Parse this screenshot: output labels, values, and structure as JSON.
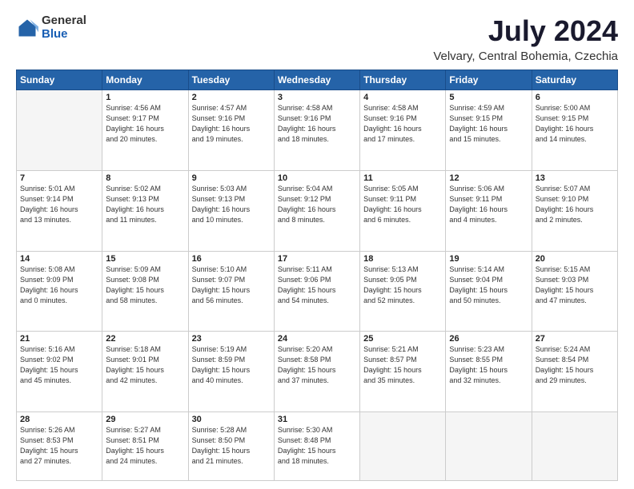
{
  "header": {
    "logo_general": "General",
    "logo_blue": "Blue",
    "title": "July 2024",
    "subtitle": "Velvary, Central Bohemia, Czechia"
  },
  "weekdays": [
    "Sunday",
    "Monday",
    "Tuesday",
    "Wednesday",
    "Thursday",
    "Friday",
    "Saturday"
  ],
  "weeks": [
    [
      {
        "day": "",
        "info": ""
      },
      {
        "day": "1",
        "info": "Sunrise: 4:56 AM\nSunset: 9:17 PM\nDaylight: 16 hours\nand 20 minutes."
      },
      {
        "day": "2",
        "info": "Sunrise: 4:57 AM\nSunset: 9:16 PM\nDaylight: 16 hours\nand 19 minutes."
      },
      {
        "day": "3",
        "info": "Sunrise: 4:58 AM\nSunset: 9:16 PM\nDaylight: 16 hours\nand 18 minutes."
      },
      {
        "day": "4",
        "info": "Sunrise: 4:58 AM\nSunset: 9:16 PM\nDaylight: 16 hours\nand 17 minutes."
      },
      {
        "day": "5",
        "info": "Sunrise: 4:59 AM\nSunset: 9:15 PM\nDaylight: 16 hours\nand 15 minutes."
      },
      {
        "day": "6",
        "info": "Sunrise: 5:00 AM\nSunset: 9:15 PM\nDaylight: 16 hours\nand 14 minutes."
      }
    ],
    [
      {
        "day": "7",
        "info": "Sunrise: 5:01 AM\nSunset: 9:14 PM\nDaylight: 16 hours\nand 13 minutes."
      },
      {
        "day": "8",
        "info": "Sunrise: 5:02 AM\nSunset: 9:13 PM\nDaylight: 16 hours\nand 11 minutes."
      },
      {
        "day": "9",
        "info": "Sunrise: 5:03 AM\nSunset: 9:13 PM\nDaylight: 16 hours\nand 10 minutes."
      },
      {
        "day": "10",
        "info": "Sunrise: 5:04 AM\nSunset: 9:12 PM\nDaylight: 16 hours\nand 8 minutes."
      },
      {
        "day": "11",
        "info": "Sunrise: 5:05 AM\nSunset: 9:11 PM\nDaylight: 16 hours\nand 6 minutes."
      },
      {
        "day": "12",
        "info": "Sunrise: 5:06 AM\nSunset: 9:11 PM\nDaylight: 16 hours\nand 4 minutes."
      },
      {
        "day": "13",
        "info": "Sunrise: 5:07 AM\nSunset: 9:10 PM\nDaylight: 16 hours\nand 2 minutes."
      }
    ],
    [
      {
        "day": "14",
        "info": "Sunrise: 5:08 AM\nSunset: 9:09 PM\nDaylight: 16 hours\nand 0 minutes."
      },
      {
        "day": "15",
        "info": "Sunrise: 5:09 AM\nSunset: 9:08 PM\nDaylight: 15 hours\nand 58 minutes."
      },
      {
        "day": "16",
        "info": "Sunrise: 5:10 AM\nSunset: 9:07 PM\nDaylight: 15 hours\nand 56 minutes."
      },
      {
        "day": "17",
        "info": "Sunrise: 5:11 AM\nSunset: 9:06 PM\nDaylight: 15 hours\nand 54 minutes."
      },
      {
        "day": "18",
        "info": "Sunrise: 5:13 AM\nSunset: 9:05 PM\nDaylight: 15 hours\nand 52 minutes."
      },
      {
        "day": "19",
        "info": "Sunrise: 5:14 AM\nSunset: 9:04 PM\nDaylight: 15 hours\nand 50 minutes."
      },
      {
        "day": "20",
        "info": "Sunrise: 5:15 AM\nSunset: 9:03 PM\nDaylight: 15 hours\nand 47 minutes."
      }
    ],
    [
      {
        "day": "21",
        "info": "Sunrise: 5:16 AM\nSunset: 9:02 PM\nDaylight: 15 hours\nand 45 minutes."
      },
      {
        "day": "22",
        "info": "Sunrise: 5:18 AM\nSunset: 9:01 PM\nDaylight: 15 hours\nand 42 minutes."
      },
      {
        "day": "23",
        "info": "Sunrise: 5:19 AM\nSunset: 8:59 PM\nDaylight: 15 hours\nand 40 minutes."
      },
      {
        "day": "24",
        "info": "Sunrise: 5:20 AM\nSunset: 8:58 PM\nDaylight: 15 hours\nand 37 minutes."
      },
      {
        "day": "25",
        "info": "Sunrise: 5:21 AM\nSunset: 8:57 PM\nDaylight: 15 hours\nand 35 minutes."
      },
      {
        "day": "26",
        "info": "Sunrise: 5:23 AM\nSunset: 8:55 PM\nDaylight: 15 hours\nand 32 minutes."
      },
      {
        "day": "27",
        "info": "Sunrise: 5:24 AM\nSunset: 8:54 PM\nDaylight: 15 hours\nand 29 minutes."
      }
    ],
    [
      {
        "day": "28",
        "info": "Sunrise: 5:26 AM\nSunset: 8:53 PM\nDaylight: 15 hours\nand 27 minutes."
      },
      {
        "day": "29",
        "info": "Sunrise: 5:27 AM\nSunset: 8:51 PM\nDaylight: 15 hours\nand 24 minutes."
      },
      {
        "day": "30",
        "info": "Sunrise: 5:28 AM\nSunset: 8:50 PM\nDaylight: 15 hours\nand 21 minutes."
      },
      {
        "day": "31",
        "info": "Sunrise: 5:30 AM\nSunset: 8:48 PM\nDaylight: 15 hours\nand 18 minutes."
      },
      {
        "day": "",
        "info": ""
      },
      {
        "day": "",
        "info": ""
      },
      {
        "day": "",
        "info": ""
      }
    ]
  ]
}
